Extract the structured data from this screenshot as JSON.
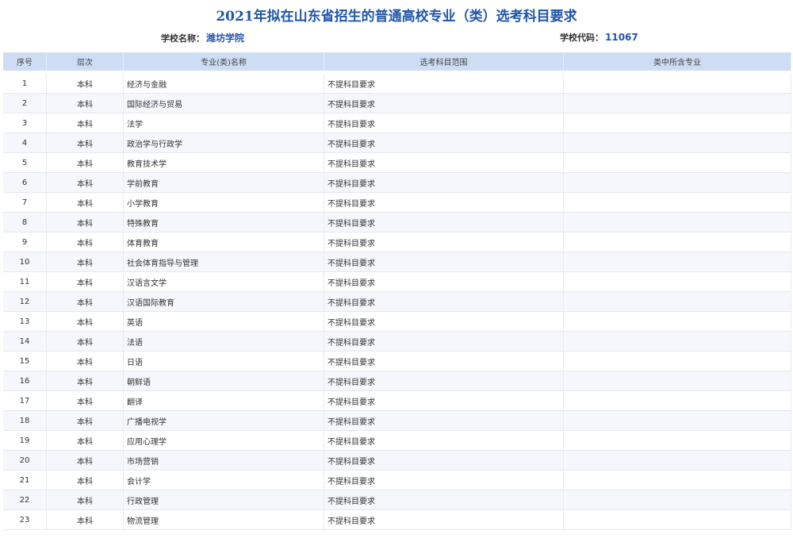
{
  "title": "2021年拟在山东省招生的普通高校专业（类）选考科目要求",
  "school_name_label": "学校名称：",
  "school_name": "潍坊学院",
  "school_code_label": "学校代码：",
  "school_code": "11067",
  "colors": {
    "title": "#1f56a8",
    "header_bg": "#cfddf4",
    "row_alt": "#f5f7fc"
  },
  "table": {
    "headers": [
      "序号",
      "层次",
      "专业(类)名称",
      "选考科目范围",
      "类中所含专业"
    ],
    "rows": [
      {
        "seq": "1",
        "level": "本科",
        "name": "经济与金融",
        "req": "不提科目要求",
        "incl": ""
      },
      {
        "seq": "2",
        "level": "本科",
        "name": "国际经济与贸易",
        "req": "不提科目要求",
        "incl": ""
      },
      {
        "seq": "3",
        "level": "本科",
        "name": "法学",
        "req": "不提科目要求",
        "incl": ""
      },
      {
        "seq": "4",
        "level": "本科",
        "name": "政治学与行政学",
        "req": "不提科目要求",
        "incl": ""
      },
      {
        "seq": "5",
        "level": "本科",
        "name": "教育技术学",
        "req": "不提科目要求",
        "incl": ""
      },
      {
        "seq": "6",
        "level": "本科",
        "name": "学前教育",
        "req": "不提科目要求",
        "incl": ""
      },
      {
        "seq": "7",
        "level": "本科",
        "name": "小学教育",
        "req": "不提科目要求",
        "incl": ""
      },
      {
        "seq": "8",
        "level": "本科",
        "name": "特殊教育",
        "req": "不提科目要求",
        "incl": ""
      },
      {
        "seq": "9",
        "level": "本科",
        "name": "体育教育",
        "req": "不提科目要求",
        "incl": ""
      },
      {
        "seq": "10",
        "level": "本科",
        "name": "社会体育指导与管理",
        "req": "不提科目要求",
        "incl": ""
      },
      {
        "seq": "11",
        "level": "本科",
        "name": "汉语言文学",
        "req": "不提科目要求",
        "incl": ""
      },
      {
        "seq": "12",
        "level": "本科",
        "name": "汉语国际教育",
        "req": "不提科目要求",
        "incl": ""
      },
      {
        "seq": "13",
        "level": "本科",
        "name": "英语",
        "req": "不提科目要求",
        "incl": ""
      },
      {
        "seq": "14",
        "level": "本科",
        "name": "法语",
        "req": "不提科目要求",
        "incl": ""
      },
      {
        "seq": "15",
        "level": "本科",
        "name": "日语",
        "req": "不提科目要求",
        "incl": ""
      },
      {
        "seq": "16",
        "level": "本科",
        "name": "朝鲜语",
        "req": "不提科目要求",
        "incl": ""
      },
      {
        "seq": "17",
        "level": "本科",
        "name": "翻译",
        "req": "不提科目要求",
        "incl": ""
      },
      {
        "seq": "18",
        "level": "本科",
        "name": "广播电视学",
        "req": "不提科目要求",
        "incl": ""
      },
      {
        "seq": "19",
        "level": "本科",
        "name": "应用心理学",
        "req": "不提科目要求",
        "incl": ""
      },
      {
        "seq": "20",
        "level": "本科",
        "name": "市场营销",
        "req": "不提科目要求",
        "incl": ""
      },
      {
        "seq": "21",
        "level": "本科",
        "name": "会计学",
        "req": "不提科目要求",
        "incl": ""
      },
      {
        "seq": "22",
        "level": "本科",
        "name": "行政管理",
        "req": "不提科目要求",
        "incl": ""
      },
      {
        "seq": "23",
        "level": "本科",
        "name": "物流管理",
        "req": "不提科目要求",
        "incl": ""
      }
    ]
  }
}
